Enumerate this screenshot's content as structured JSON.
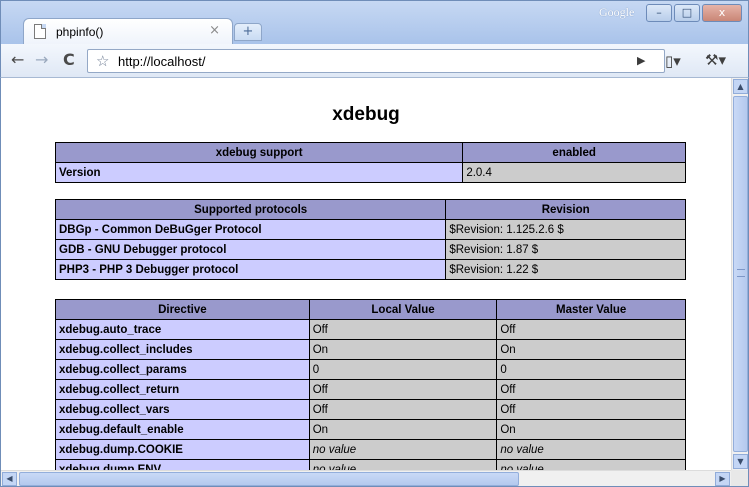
{
  "window": {
    "tab_title": "phpinfo()",
    "tab_close": "×",
    "new_tab": "+",
    "brand": "Google",
    "minimize": "–",
    "maximize": "□",
    "close": "x"
  },
  "toolbar": {
    "back": "←",
    "forward": "→",
    "reload": "C",
    "star": "☆",
    "address": "http://localhost/",
    "go": "▶",
    "page_menu": "▯▾",
    "wrench_menu": "⚒▾"
  },
  "page": {
    "title": "xdebug"
  },
  "support_table": {
    "headers": [
      "xdebug support",
      "enabled"
    ],
    "rows": [
      [
        "Version",
        "2.0.4"
      ]
    ]
  },
  "protocols_table": {
    "headers": [
      "Supported protocols",
      "Revision"
    ],
    "rows": [
      [
        "DBGp - Common DeBuGger Protocol",
        "$Revision: 1.125.2.6 $"
      ],
      [
        "GDB - GNU Debugger protocol",
        "$Revision: 1.87 $"
      ],
      [
        "PHP3 - PHP 3 Debugger protocol",
        "$Revision: 1.22 $"
      ]
    ]
  },
  "directive_table": {
    "headers": [
      "Directive",
      "Local Value",
      "Master Value"
    ],
    "rows": [
      [
        "xdebug.auto_trace",
        "Off",
        "Off"
      ],
      [
        "xdebug.collect_includes",
        "On",
        "On"
      ],
      [
        "xdebug.collect_params",
        "0",
        "0"
      ],
      [
        "xdebug.collect_return",
        "Off",
        "Off"
      ],
      [
        "xdebug.collect_vars",
        "Off",
        "Off"
      ],
      [
        "xdebug.default_enable",
        "On",
        "On"
      ],
      [
        "xdebug.dump.COOKIE",
        "no value",
        "no value"
      ],
      [
        "xdebug.dump.ENV",
        "no value",
        "no value"
      ]
    ]
  },
  "scrollbars": {
    "up": "▲",
    "down": "▼",
    "left": "◀",
    "right": "▶"
  },
  "colors": {
    "header_bg": "#9999cc",
    "key_bg": "#ccccff",
    "value_bg": "#cccccc"
  }
}
